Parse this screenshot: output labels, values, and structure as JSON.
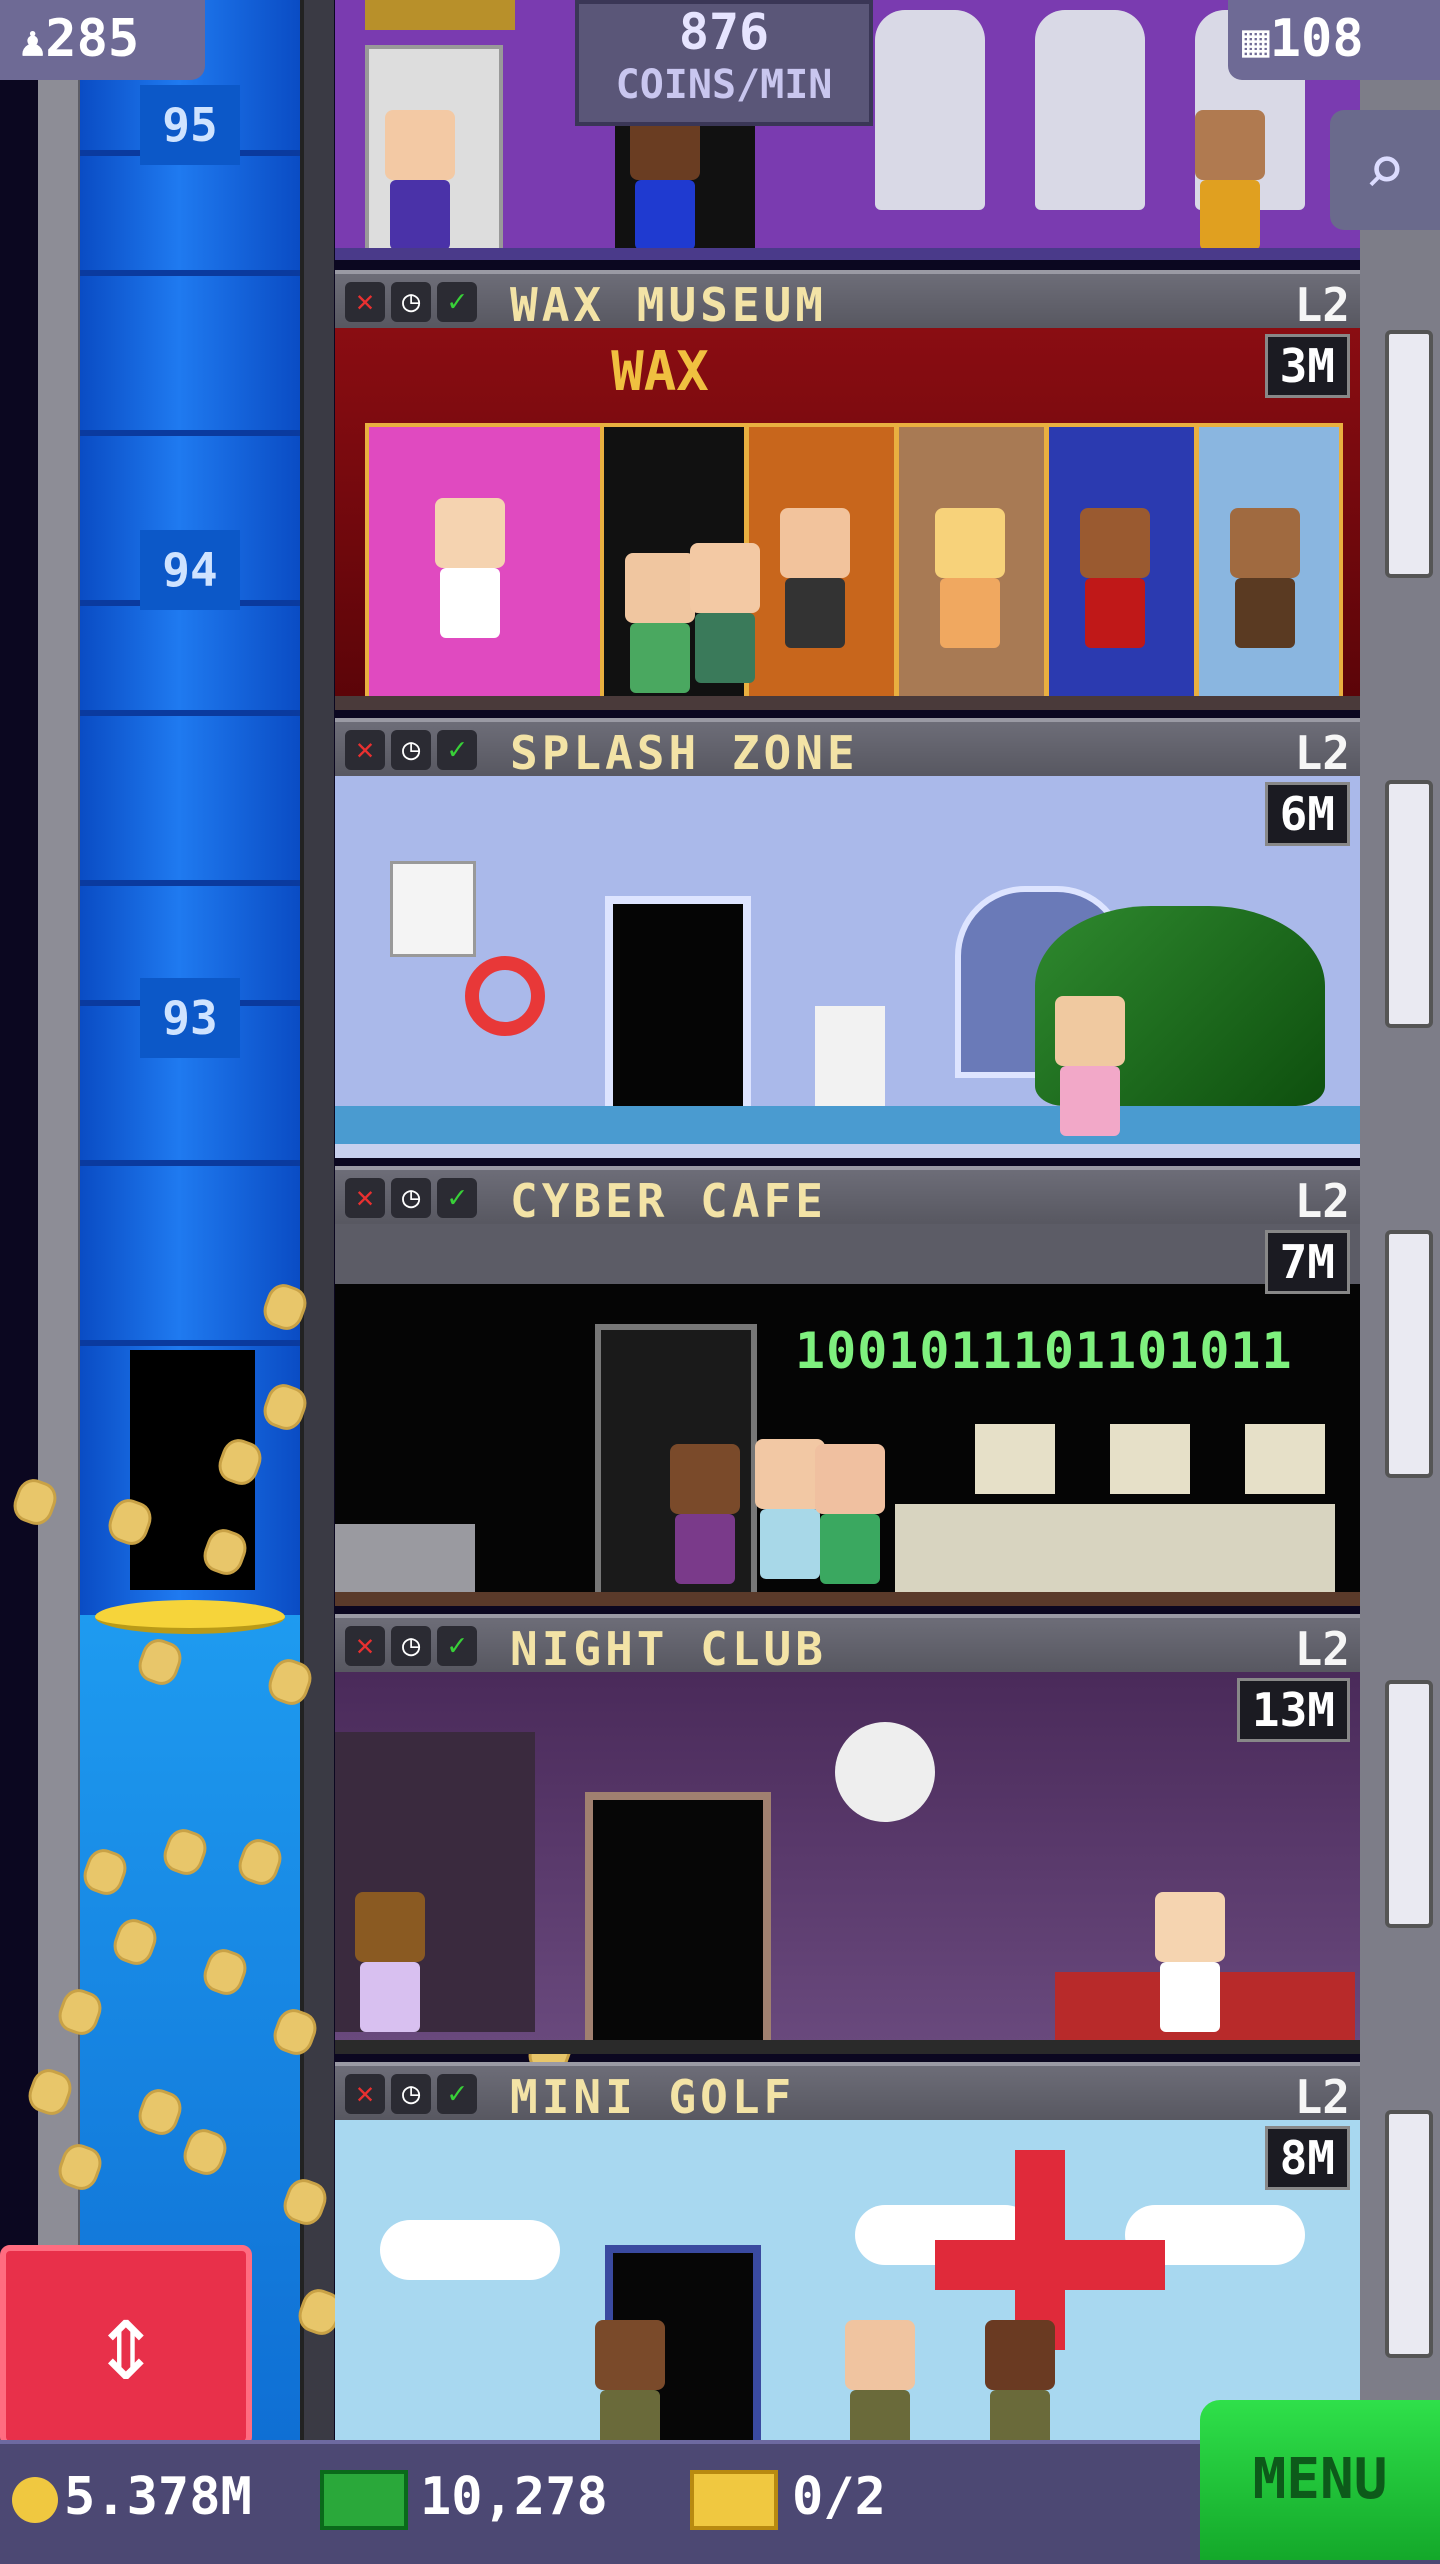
{
  "top_bar": {
    "population": "285",
    "coins_per_min_value": "876",
    "coins_per_min_label": "COINS/MIN",
    "floors_count": "108"
  },
  "shaft": {
    "floor_numbers": [
      "95",
      "94",
      "93"
    ]
  },
  "floors": [
    {
      "name": "WAX MUSEUM",
      "level": "L2",
      "price": "3M",
      "sign": "WAX"
    },
    {
      "name": "SPLASH ZONE",
      "level": "L2",
      "price": "6M"
    },
    {
      "name": "CYBER CAFE",
      "level": "L2",
      "price": "7M",
      "binary": "1001011101101011"
    },
    {
      "name": "NIGHT CLUB",
      "level": "L2",
      "price": "13M"
    },
    {
      "name": "MINI GOLF",
      "level": "L2",
      "price": "8M"
    }
  ],
  "bottom_bar": {
    "coins": "5.378M",
    "bux": "10,278",
    "tickets": "0/2",
    "menu_label": "MENU"
  },
  "icons": {
    "population": "person-icon",
    "floors": "building-icon",
    "search": "magnifier-icon",
    "coins": "coin-icon",
    "bux": "cash-icon",
    "tickets": "ticket-icon",
    "elevator": "up-down-arrows-icon"
  },
  "colors": {
    "floor_name": "#f3e3a6",
    "menu_green": "#2fe04a",
    "elevator_red": "#e8304a"
  }
}
